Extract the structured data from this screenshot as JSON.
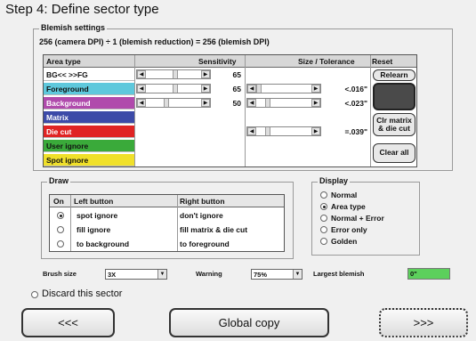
{
  "step_title": "Step 4: Define sector type",
  "blemish": {
    "group_title": "Blemish settings",
    "formula": "256 (camera DPI) ÷ 1 (blemish reduction) = 256 (blemish DPI)",
    "headers": {
      "area_type": "Area type",
      "sensitivity": "Sensitivity",
      "size_tolerance": "Size / Tolerance",
      "reset": "Reset"
    },
    "rows": [
      {
        "label": "BG<< >>FG",
        "color": "#ffffff",
        "sensitivity": "65",
        "size": ""
      },
      {
        "label": "Foreground",
        "color": "#5ec8dc",
        "sensitivity": "65",
        "size": "<.016\""
      },
      {
        "label": "Background",
        "color": "#b04aac",
        "sensitivity": "50",
        "size": "<.023\""
      },
      {
        "label": "Matrix",
        "color": "#3c4aa8",
        "sensitivity": "",
        "size": ""
      },
      {
        "label": "Die cut",
        "color": "#e02424",
        "sensitivity": "",
        "size": "=.039\""
      },
      {
        "label": "User ignore",
        "color": "#3aaa3a",
        "sensitivity": "",
        "size": ""
      },
      {
        "label": "Spot ignore",
        "color": "#f0e02a",
        "sensitivity": "",
        "size": ""
      }
    ],
    "buttons": {
      "relearn": "Relearn",
      "clr_matrix": "Clr matrix & die cut",
      "clear_all": "Clear all"
    }
  },
  "draw": {
    "group_title": "Draw",
    "headers": {
      "on": "On",
      "left": "Left button",
      "right": "Right button"
    },
    "rows": [
      {
        "left": "spot ignore",
        "right": "don't ignore",
        "selected": true
      },
      {
        "left": "fill ignore",
        "right": "fill matrix & die cut",
        "selected": false
      },
      {
        "left": "to background",
        "right": "to foreground",
        "selected": false
      }
    ]
  },
  "display": {
    "group_title": "Display",
    "options": [
      {
        "label": "Normal",
        "selected": false
      },
      {
        "label": "Area type",
        "selected": true
      },
      {
        "label": "Normal + Error",
        "selected": false
      },
      {
        "label": "Error only",
        "selected": false
      },
      {
        "label": "Golden",
        "selected": false
      }
    ]
  },
  "bottom": {
    "brush_size_label": "Brush size",
    "brush_size_value": "3X",
    "warning_label": "Warning",
    "warning_value": "75%",
    "largest_blemish_label": "Largest blemish",
    "largest_blemish_value": "0\"",
    "largest_blemish_color": "#5cd05c"
  },
  "discard_label": "Discard this sector",
  "nav": {
    "back": "<<<",
    "global_copy": "Global copy",
    "next": ">>>"
  }
}
